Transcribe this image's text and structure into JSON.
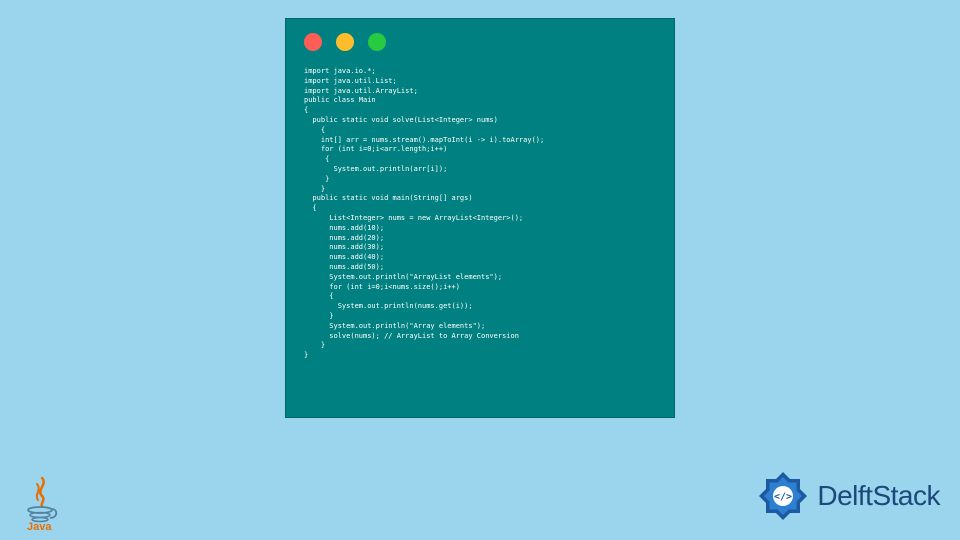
{
  "code": {
    "lines": [
      "import java.io.*;",
      "import java.util.List;",
      "import java.util.ArrayList;",
      "public class Main",
      "{",
      "  public static void solve(List<Integer> nums)",
      "    {",
      "    int[] arr = nums.stream().mapToInt(i -> i).toArray();",
      "    for (int i=0;i<arr.length;i++)",
      "     {",
      "       System.out.println(arr[i]);",
      "     }",
      "    }",
      "  public static void main(String[] args)",
      "  {",
      "      List<Integer> nums = new ArrayList<Integer>();",
      "      nums.add(10);",
      "      nums.add(20);",
      "      nums.add(30);",
      "      nums.add(40);",
      "      nums.add(50);",
      "      System.out.println(\"ArrayList elements\");",
      "      for (int i=0;i<nums.size();i++)",
      "      {",
      "        System.out.println(nums.get(i));",
      "      }",
      "      System.out.println(\"Array elements\");",
      "      solve(nums); // ArrayList to Array Conversion",
      "    }",
      "}"
    ]
  },
  "logos": {
    "java_label": "Java",
    "delft_label": "DelftStack"
  }
}
